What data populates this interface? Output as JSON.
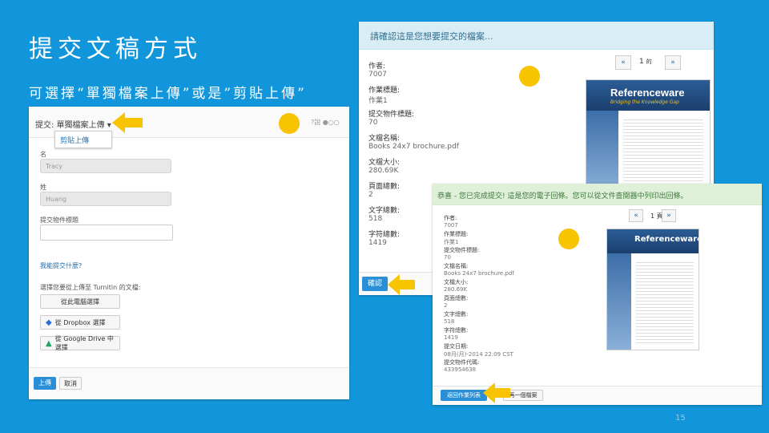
{
  "slide": {
    "title": "提交文稿方式",
    "subtitle": "可選擇“單獨檔案上傳”或是”剪貼上傳”",
    "page_number": "15"
  },
  "left_panel": {
    "header_label": "提交: 單獨檔案上傳 ▾",
    "dropdown_item": "剪貼上傳",
    "right_hint": "?說 ●○○",
    "field1_label": "名",
    "field1_value": "Tracy",
    "field2_label": "姓",
    "field2_value": "Huang",
    "field3_label": "提交物件標題",
    "link_text": "我能提交什麼?",
    "choose_label": "選擇您要從上傳至 Turnitin 的文檔:",
    "btn_computer": "從此電腦選擇",
    "btn_dropbox": "從 Dropbox 選擇",
    "btn_gdrive": "從 Google Drive 中選擇",
    "btn_upload": "上傳",
    "btn_cancel": "取消"
  },
  "middle_panel": {
    "header": "請確認這是您想要提交的檔案...",
    "pager_prev": "«",
    "pager_page": "1",
    "pager_of": "的",
    "pager_next": "»",
    "meta": [
      {
        "label": "作者:",
        "value": "7007"
      },
      {
        "label": "作業標題:",
        "value": "作業1"
      },
      {
        "label": "提交物件標題:",
        "value": "70"
      },
      {
        "label": "文檔名稱:",
        "value": "Books 24x7 brochure.pdf"
      },
      {
        "label": "文檔大小:",
        "value": "280.69K"
      },
      {
        "label": "頁面總數:",
        "value": "2"
      },
      {
        "label": "文字總數:",
        "value": "518"
      },
      {
        "label": "字符總數:",
        "value": "1419"
      }
    ],
    "confirm_button": "確認"
  },
  "right_panel": {
    "header": "恭喜 - 您已完成提交! 這是您的電子回條。您可以從文件查閱器中列印出回條。",
    "pager_prev": "«",
    "pager_page": "1 頁",
    "pager_next": "»",
    "meta": [
      {
        "label": "作者:",
        "value": "7007"
      },
      {
        "label": "作業標題:",
        "value": "作業1"
      },
      {
        "label": "提交物件標題:",
        "value": "70"
      },
      {
        "label": "文檔名稱:",
        "value": "Books 24x7 brochure.pdf"
      },
      {
        "label": "文檔大小:",
        "value": "280.69K"
      },
      {
        "label": "頁面總數:",
        "value": "2"
      },
      {
        "label": "文字總數:",
        "value": "518"
      },
      {
        "label": "字符總數:",
        "value": "1419"
      },
      {
        "label": "提交日期:",
        "value": "08月(月)-2014 22:09 CST"
      },
      {
        "label": "提交物件代碼:",
        "value": "433954638"
      }
    ],
    "btn_return": "返回作業列表",
    "btn_next": "再一個檔案"
  },
  "document_preview": {
    "brand": "Referenceware",
    "tagline": "Bridging the Knowledge Gap"
  },
  "colors": {
    "background": "#1296db",
    "arrow": "#f8c300",
    "success_header": "#dff0d8",
    "info_header": "#d9edf7",
    "primary_button": "#2a8fd6"
  }
}
